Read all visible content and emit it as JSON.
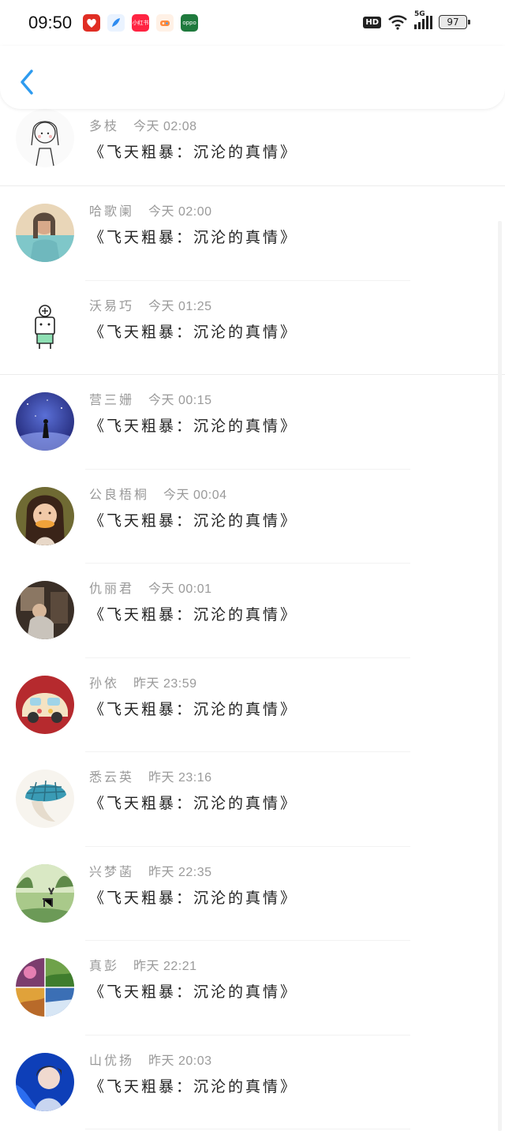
{
  "status_bar": {
    "time": "09:50",
    "network": "5G",
    "hd": "HD",
    "battery": "97",
    "app_icons": [
      {
        "name": "pinduoduo-icon",
        "label": "",
        "color": "#e02e24"
      },
      {
        "name": "feather-app-icon",
        "label": "",
        "color": "#2f8cf0"
      },
      {
        "name": "xiaohongshu-icon",
        "label": "小红书",
        "color": "#ff2442"
      },
      {
        "name": "game-app-icon",
        "label": "",
        "color": "#ff8a3d"
      },
      {
        "name": "oppo-icon",
        "label": "oppo",
        "color": "#1f7a3d"
      }
    ]
  },
  "header": {
    "back_icon": "chevron-left-icon",
    "accent_color": "#2e9bef"
  },
  "messages": [
    {
      "user": "多枝",
      "time": "今天 02:08",
      "text": "《飞天粗暴：沉沦的真情》",
      "avatar": "sketch-girl"
    },
    {
      "user": "哈歌阑",
      "time": "今天 02:00",
      "text": "《飞天粗暴：沉沦的真情》",
      "avatar": "woman-portrait"
    },
    {
      "user": "沃易巧",
      "time": "今天 01:25",
      "text": "《飞天粗暴：沉沦的真情》",
      "avatar": "cartoon-robot"
    },
    {
      "user": "营三姗",
      "time": "今天 00:15",
      "text": "《飞天粗暴：沉沦的真情》",
      "avatar": "night-sky"
    },
    {
      "user": "公良梧桐",
      "time": "今天 00:04",
      "text": "《飞天粗暴：沉沦的真情》",
      "avatar": "girl-eating"
    },
    {
      "user": "仇丽君",
      "time": "今天 00:01",
      "text": "《飞天粗暴：沉沦的真情》",
      "avatar": "dim-room"
    },
    {
      "user": "孙依",
      "time": "昨天 23:59",
      "text": "《飞天粗暴：沉沦的真情》",
      "avatar": "toy-car"
    },
    {
      "user": "悉云英",
      "time": "昨天 23:16",
      "text": "《飞天粗暴：沉沦的真情》",
      "avatar": "plaid-cap"
    },
    {
      "user": "兴梦菡",
      "time": "昨天 22:35",
      "text": "《飞天粗暴：沉沦的真情》",
      "avatar": "deer-forest"
    },
    {
      "user": "真彭",
      "time": "昨天 22:21",
      "text": "《飞天粗暴：沉沦的真情》",
      "avatar": "photo-collage"
    },
    {
      "user": "山优扬",
      "time": "昨天 20:03",
      "text": "《飞天粗暴：沉沦的真情》",
      "avatar": "blue-portrait"
    }
  ]
}
